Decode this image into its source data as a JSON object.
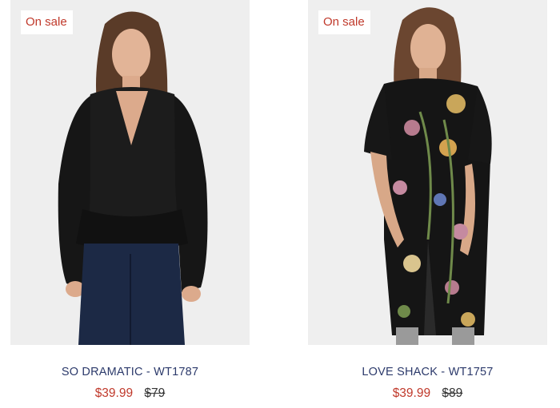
{
  "products": [
    {
      "badge": "On sale",
      "title": "SO DRAMATIC - WT1787",
      "sale_price": "$39.99",
      "original_price": "$79"
    },
    {
      "badge": "On sale",
      "title": "LOVE SHACK - WT1757",
      "sale_price": "$39.99",
      "original_price": "$89"
    }
  ],
  "colors": {
    "sale_red": "#c0392b",
    "title_navy": "#2c3a6b",
    "photo_bg": "#efefef"
  }
}
